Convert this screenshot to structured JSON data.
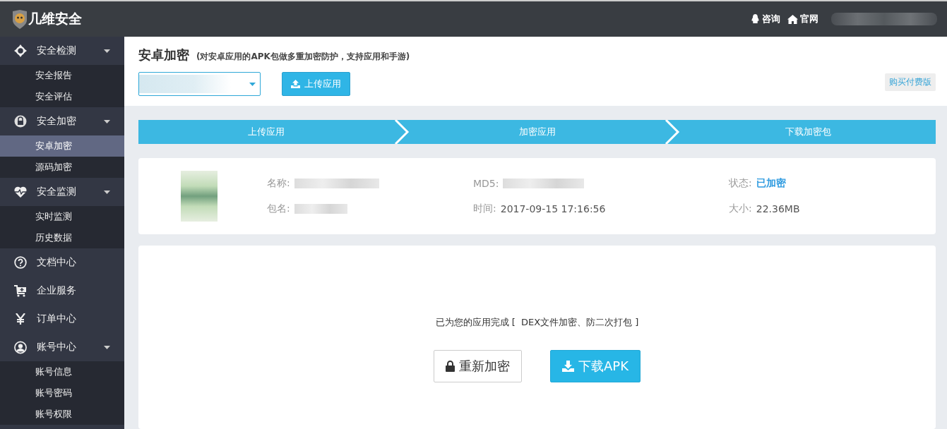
{
  "header": {
    "logo": "几维安全",
    "links": [
      {
        "label": "咨询"
      },
      {
        "label": "官网"
      }
    ]
  },
  "sidebar": {
    "items": [
      {
        "label": "安全检测",
        "expanded": true,
        "children": [
          {
            "label": "安全报告",
            "selected": false
          },
          {
            "label": "安全评估",
            "selected": false
          }
        ]
      },
      {
        "label": "安全加密",
        "expanded": true,
        "children": [
          {
            "label": "安卓加密",
            "selected": true
          },
          {
            "label": "源码加密",
            "selected": false
          }
        ]
      },
      {
        "label": "安全监测",
        "expanded": true,
        "children": [
          {
            "label": "实时监测",
            "selected": false
          },
          {
            "label": "历史数据",
            "selected": false
          }
        ]
      },
      {
        "label": "文档中心"
      },
      {
        "label": "企业服务"
      },
      {
        "label": "订单中心"
      },
      {
        "label": "账号中心",
        "expanded": true,
        "children": [
          {
            "label": "账号信息",
            "selected": false
          },
          {
            "label": "账号密码",
            "selected": false
          },
          {
            "label": "账号权限",
            "selected": false
          }
        ]
      }
    ]
  },
  "page": {
    "title": "安卓加密",
    "subtitle": "(对安卓应用的APK包做多重加密防护，支持应用和手游)",
    "upload_button": "上传应用",
    "buy_button": "购买付费版"
  },
  "steps": [
    {
      "label": "上传应用"
    },
    {
      "label": "加密应用"
    },
    {
      "label": "下载加密包"
    }
  ],
  "app_info": {
    "fields": [
      {
        "label": "名称:",
        "kind": "redacted"
      },
      {
        "label": "包名:",
        "kind": "redacted"
      },
      {
        "label": "MD5:",
        "kind": "redacted"
      },
      {
        "label": "时间:",
        "kind": "text",
        "value": "2017-09-15 17:16:56"
      },
      {
        "label": "状态:",
        "kind": "status",
        "value": "已加密"
      },
      {
        "label": "大小:",
        "kind": "text",
        "value": "22.36MB"
      }
    ]
  },
  "result": {
    "message": "已为您的应用完成 [  DEX文件加密、防二次打包 ]",
    "buttons": [
      {
        "kind": "secondary",
        "label": "重新加密"
      },
      {
        "kind": "primary",
        "label": "下载APK"
      }
    ]
  }
}
